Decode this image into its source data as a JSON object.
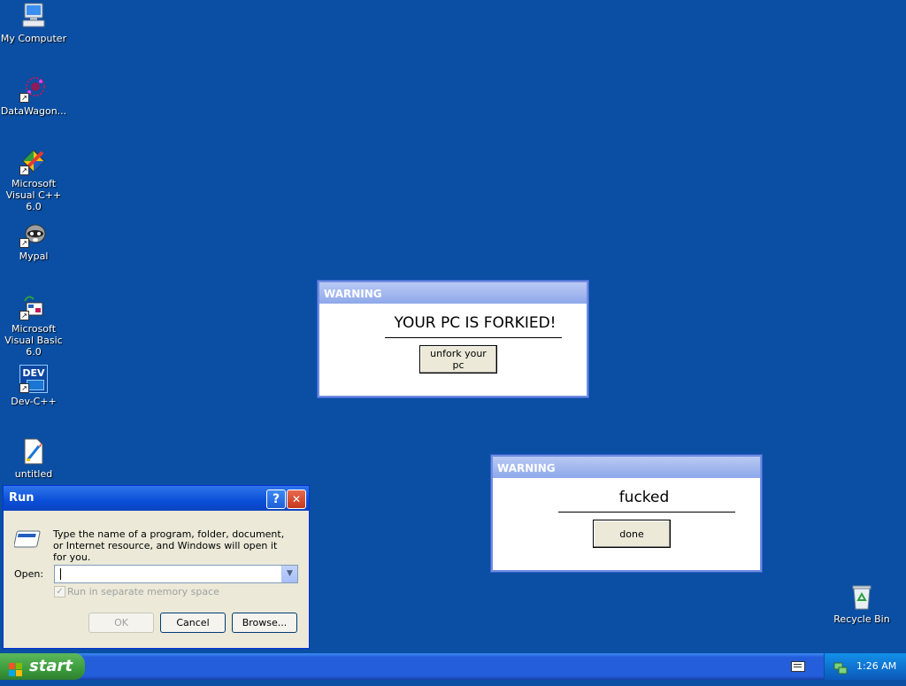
{
  "desktop": {
    "icons": [
      {
        "label": "My Computer",
        "icon": "my-computer-icon"
      },
      {
        "label": "DataWagon...",
        "icon": "datawagon-icon"
      },
      {
        "label": "Microsoft Visual C++ 6.0",
        "icon": "visual-cpp-icon"
      },
      {
        "label": "Mypal",
        "icon": "mypal-icon"
      },
      {
        "label": "Microsoft Visual Basic 6.0",
        "icon": "visual-basic-icon"
      },
      {
        "label": "Dev-C++",
        "icon": "devcpp-icon",
        "badge": "DEV"
      },
      {
        "label": "untitled",
        "icon": "paint-file-icon"
      },
      {
        "label": "Recycle Bin",
        "icon": "recycle-bin-icon"
      }
    ]
  },
  "popups": [
    {
      "title": "WARNING",
      "message": "YOUR PC IS FORKIED!",
      "button": "unfork your pc"
    },
    {
      "title": "WARNING",
      "message": "fucked",
      "button": "done"
    }
  ],
  "run_dialog": {
    "title": "Run",
    "help_glyph": "?",
    "close_glyph": "✕",
    "description": "Type the name of a program, folder, document, or Internet resource, and Windows will open it for you.",
    "open_label": "Open:",
    "open_value": "",
    "checkbox_label": "Run in separate memory space",
    "checkbox_checked": true,
    "checkbox_enabled": false,
    "ok_label": "OK",
    "cancel_label": "Cancel",
    "browse_label": "Browse..."
  },
  "taskbar": {
    "start_label": "start",
    "clock": "1:26 AM"
  },
  "colors": {
    "desktop": "#0a4fa3",
    "popup_title": "#8ea8ea",
    "start_green": "#3c9c3c",
    "taskbar_blue": "#245edb"
  }
}
